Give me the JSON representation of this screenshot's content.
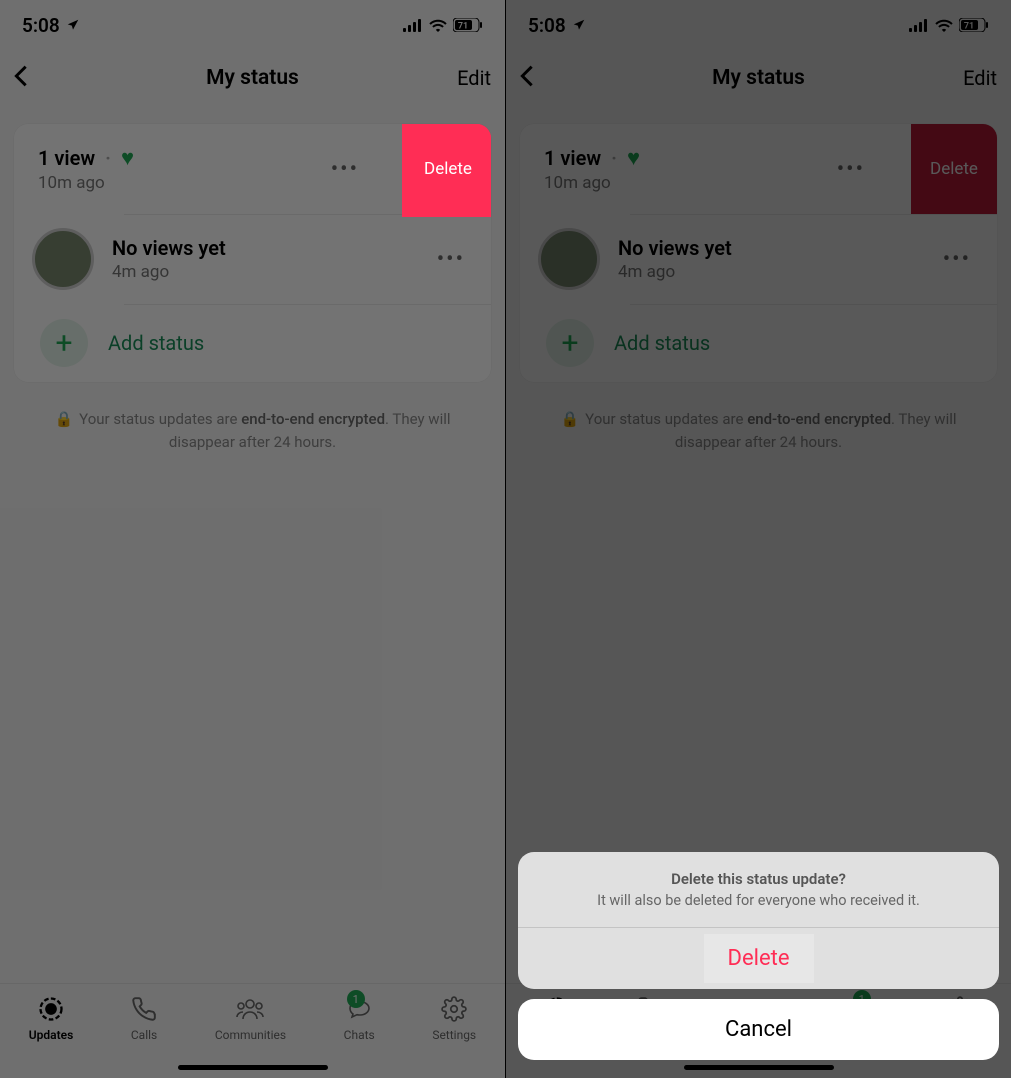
{
  "statusbar": {
    "time": "5:08",
    "battery": "71"
  },
  "header": {
    "title": "My status",
    "edit": "Edit"
  },
  "statuses": [
    {
      "views": "1 view",
      "time": "10m ago",
      "delete": "Delete"
    },
    {
      "views": "No views yet",
      "time": "4m ago"
    }
  ],
  "add": {
    "label": "Add status"
  },
  "footnote": {
    "pre": "Your status updates are ",
    "enc": "end-to-end encrypted",
    "post": ". They will disappear after 24 hours."
  },
  "tabs": {
    "updates": "Updates",
    "calls": "Calls",
    "communities": "Communities",
    "chats": "Chats",
    "settings": "Settings",
    "chat_badge": "1"
  },
  "sheet": {
    "title": "Delete this status update?",
    "sub": "It will also be deleted for everyone who received it.",
    "delete": "Delete",
    "cancel": "Cancel"
  }
}
